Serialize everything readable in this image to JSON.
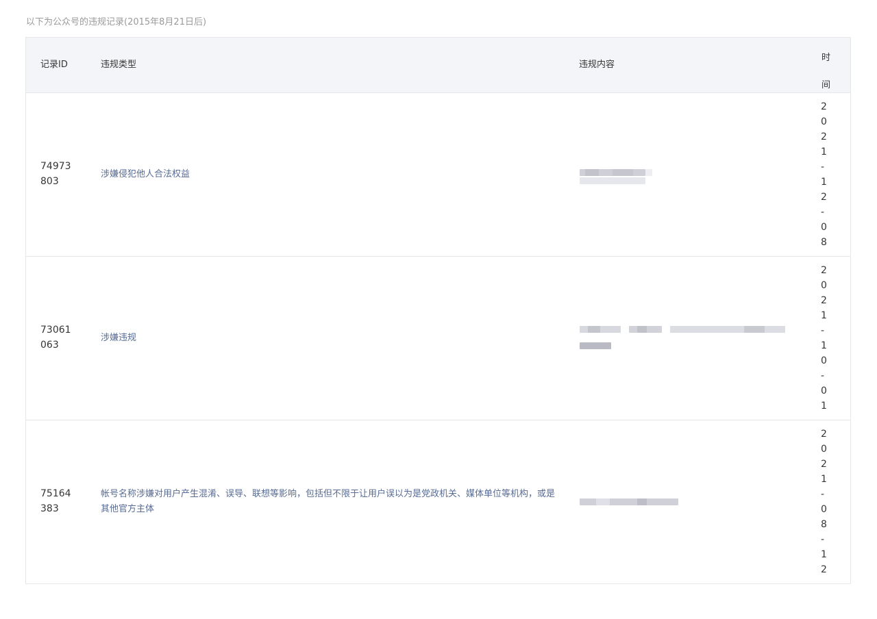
{
  "caption": "以下为公众号的违规记录(2015年8月21日后)",
  "columns": {
    "record_id": "记录ID",
    "violation_type": "违规类型",
    "violation_content": "违规内容",
    "time": "时间"
  },
  "rows": [
    {
      "record_id": "74973803",
      "violation_type": "涉嫌侵犯他人合法权益",
      "time": "2021-12-08"
    },
    {
      "record_id": "73061063",
      "violation_type": "涉嫌违规",
      "time": "2021-10-01"
    },
    {
      "record_id": "75164383",
      "violation_type": "帐号名称涉嫌对用户产生混淆、误导、联想等影响，包括但不限于让用户误以为是党政机关、媒体单位等机构，或是其他官方主体",
      "time": "2021-08-12"
    }
  ],
  "colors": {
    "header_bg": "#f4f5f9",
    "border": "#e7e7eb",
    "link_text": "#576b95",
    "caption_text": "#9a9a9a",
    "blurred_content": "#d6d7de"
  }
}
